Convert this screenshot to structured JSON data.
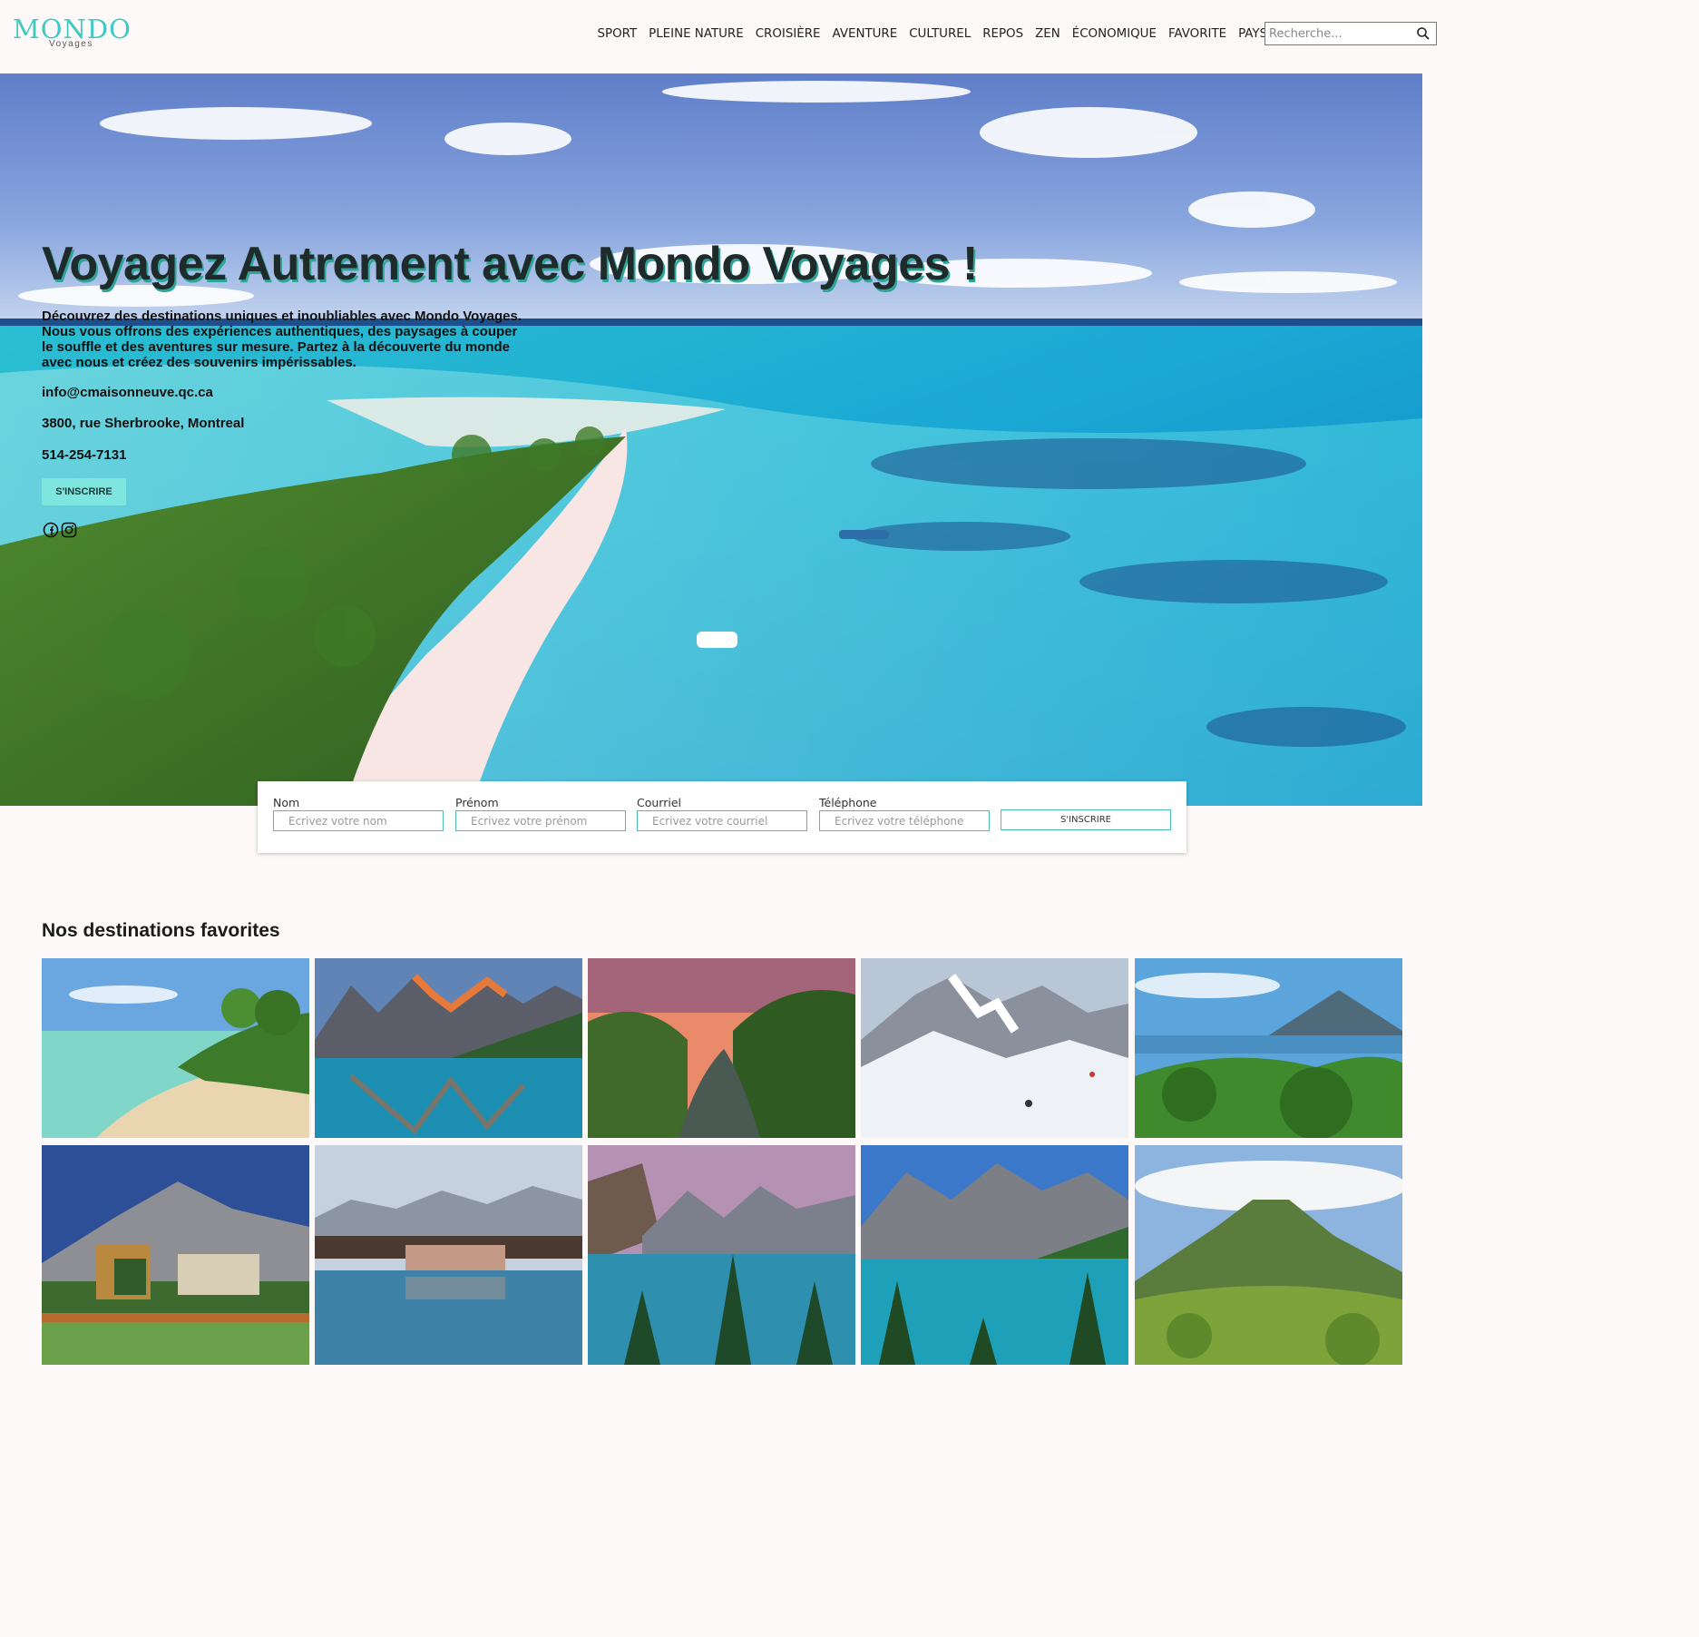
{
  "brand": {
    "name": "MONDO",
    "tagline": "Voyages",
    "accent_color": "#3fc9c2"
  },
  "nav": {
    "items": [
      "SPORT",
      "PLEINE NATURE",
      "CROISIÈRE",
      "AVENTURE",
      "CULTUREL",
      "REPOS",
      "ZEN",
      "ÉCONOMIQUE",
      "FAVORITE",
      "PAYS"
    ]
  },
  "search": {
    "placeholder": "Recherche...",
    "icon": "search-icon"
  },
  "hero": {
    "title": "Voyagez Autrement avec Mondo Voyages !",
    "description": "Découvrez des destinations uniques et inoubliables avec Mondo Voyages. Nous vous offrons des expériences authentiques, des paysages à couper le souffle et des aventures sur mesure. Partez à la découverte du monde avec nous et créez des souvenirs impérissables.",
    "email": "info@cmaisonneuve.qc.ca",
    "address": "3800, rue Sherbrooke, Montreal",
    "phone": "514-254-7131",
    "cta_label": "S'INSCRIRE",
    "cta_color": "#7ee5df",
    "social_icons": [
      "facebook-icon",
      "instagram-icon"
    ]
  },
  "form": {
    "fields": [
      {
        "label": "Nom",
        "placeholder": "Ecrivez votre nom"
      },
      {
        "label": "Prénom",
        "placeholder": "Ecrivez votre prénom"
      },
      {
        "label": "Courriel",
        "placeholder": "Ecrivez votre courriel"
      },
      {
        "label": "Téléphone",
        "placeholder": "Ecrivez votre téléphone"
      }
    ],
    "submit_label": "S'INSCRIRE"
  },
  "destinations": {
    "title": "Nos destinations favorites",
    "count": 10
  }
}
